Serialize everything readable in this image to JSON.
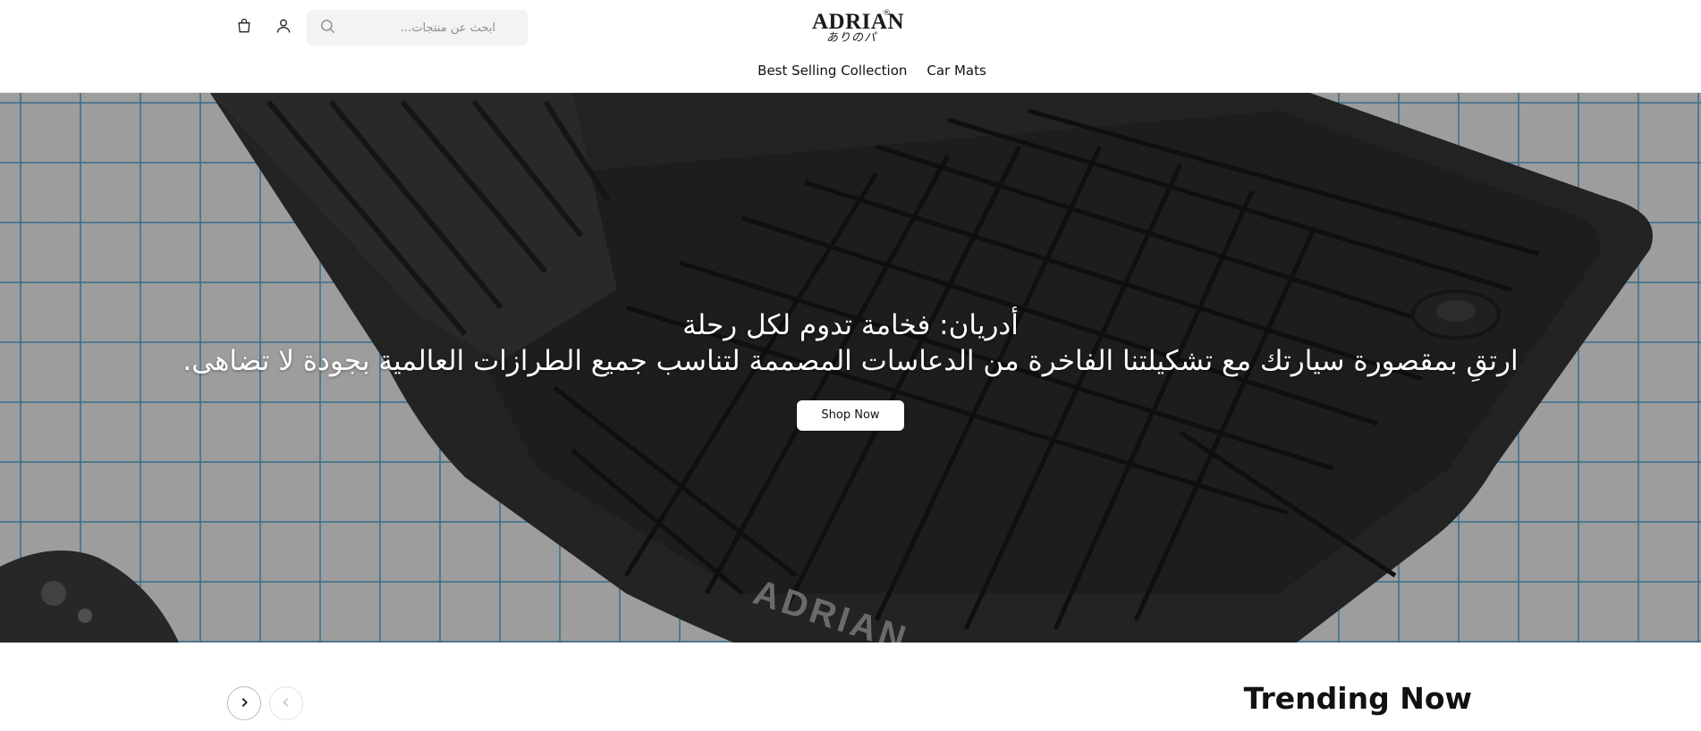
{
  "header": {
    "search": {
      "placeholder": "ابحث عن منتجات...",
      "value": ""
    },
    "icons": {
      "cart": "shopping-bag-icon",
      "account": "user-icon",
      "search": "search-icon"
    },
    "logo": {
      "text": "ADRIAN",
      "subtext": "ありのパ",
      "registered": "®"
    }
  },
  "nav": {
    "items": [
      {
        "label": "Best Selling Collection"
      },
      {
        "label": "Car Mats"
      }
    ]
  },
  "hero": {
    "title": "أدريان: فخامة تدوم لكل رحلة",
    "subtitle": "ارتقِ بمقصورة سيارتك مع تشكيلتنا الفاخرة من الدعاسات المصممة لتناسب جميع الطرازات العالمية بجودة لا تضاهى.",
    "button_label": "Shop Now",
    "mat_brand": "ADRIAN"
  },
  "trending": {
    "title": "Trending Now",
    "icons": {
      "next": "chevron-right-icon",
      "prev": "chevron-left-icon"
    }
  },
  "colors": {
    "hero_grid_line": "#468cb4",
    "mat": "#2b2b2b",
    "button_bg": "#ffffff"
  }
}
